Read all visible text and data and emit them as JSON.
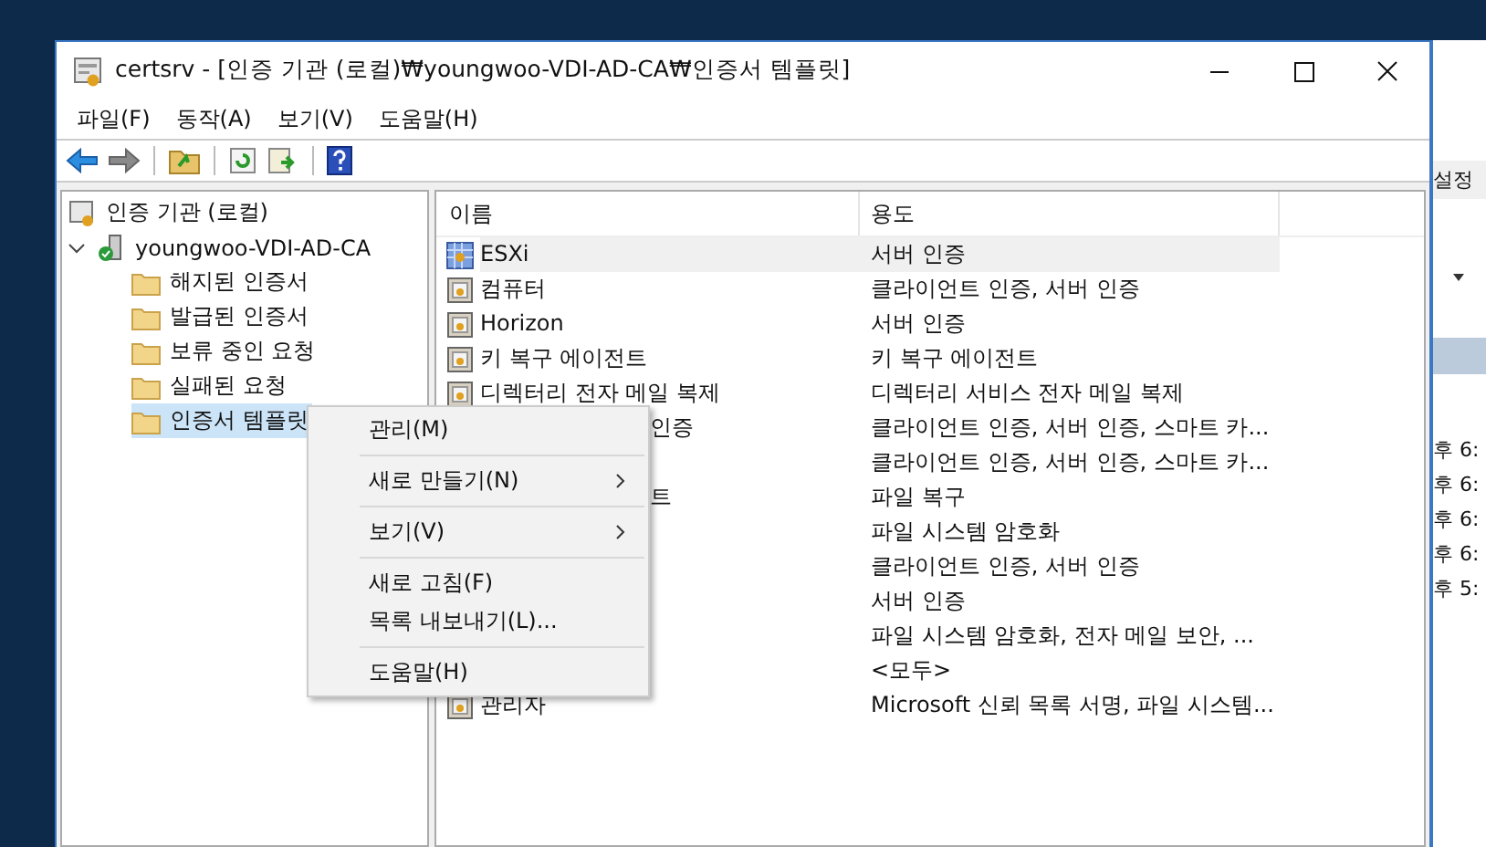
{
  "window": {
    "title": "certsrv - [인증 기관 (로컬)₩youngwoo-VDI-AD-CA₩인증서 템플릿]"
  },
  "menu": [
    "파일(F)",
    "동작(A)",
    "보기(V)",
    "도움말(H)"
  ],
  "tree": {
    "label": "인증 기관 (로컬)",
    "children": [
      {
        "label": "youngwoo-VDI-AD-CA",
        "expanded": true,
        "children": [
          {
            "label": "해지된 인증서",
            "selected": false
          },
          {
            "label": "발급된 인증서",
            "selected": false
          },
          {
            "label": "보류 중인 요청",
            "selected": false
          },
          {
            "label": "실패된 요청",
            "selected": false
          },
          {
            "label": "인증서 템플릿",
            "selected": true
          }
        ]
      }
    ]
  },
  "table": {
    "columns": [
      "이름",
      "용도"
    ],
    "rows": [
      {
        "kind": "full",
        "name": "ESXi",
        "selected": true,
        "purpose": "서버 인증"
      },
      {
        "kind": "full",
        "name": "컴퓨터",
        "selected": false,
        "purpose": "클라이언트 인증, 서버 인증"
      },
      {
        "kind": "full",
        "name": "Horizon",
        "selected": false,
        "purpose": "서버 인증"
      },
      {
        "kind": "full",
        "name": "키 복구 에이전트",
        "selected": false,
        "purpose": "키 복구 에이전트"
      },
      {
        "kind": "full",
        "name": "디렉터리 전자 메일 복제",
        "selected": false,
        "purpose": "디렉터리 서비스 전자 메일 복제"
      },
      {
        "kind": "covered",
        "name": "인증",
        "selected": false,
        "purpose": "클라이언트 인증, 서버 인증, 스마트 카..."
      },
      {
        "kind": "covered",
        "selected": false,
        "purpose": "클라이언트 인증, 서버 인증, 스마트 카..."
      },
      {
        "kind": "covered",
        "name": "트",
        "selected": false,
        "purpose": "파일 복구"
      },
      {
        "kind": "covered",
        "selected": false,
        "purpose": "파일 시스템 암호화"
      },
      {
        "kind": "covered",
        "selected": false,
        "purpose": "클라이언트 인증, 서버 인증"
      },
      {
        "kind": "covered",
        "selected": false,
        "purpose": "서버 인증"
      },
      {
        "kind": "covered",
        "selected": false,
        "purpose": "파일 시스템 암호화, 전자 메일 보안, ..."
      },
      {
        "kind": "covered",
        "selected": false,
        "purpose": "<모두>"
      },
      {
        "kind": "full",
        "name": "관리자",
        "selected": false,
        "purpose": "Microsoft 신뢰 목록 서명, 파일 시스템..."
      }
    ]
  },
  "context_menu": [
    {
      "label": "관리(M)",
      "kind": "item",
      "separator_after": true
    },
    {
      "label": "새로 만들기(N)",
      "kind": "submenu",
      "separator_after": true
    },
    {
      "label": "보기(V)",
      "kind": "submenu",
      "separator_after": true
    },
    {
      "label": "새로 고침(F)",
      "kind": "item",
      "separator_after": false
    },
    {
      "label": "목록 내보내기(L)...",
      "kind": "item",
      "separator_after": true
    },
    {
      "label": "도움말(H)",
      "kind": "item",
      "separator_after": false
    }
  ],
  "background_window": {
    "label": "설정",
    "times": [
      "후 6:",
      "후 6:",
      "후 6:",
      "후 6:",
      "후 5:"
    ]
  }
}
